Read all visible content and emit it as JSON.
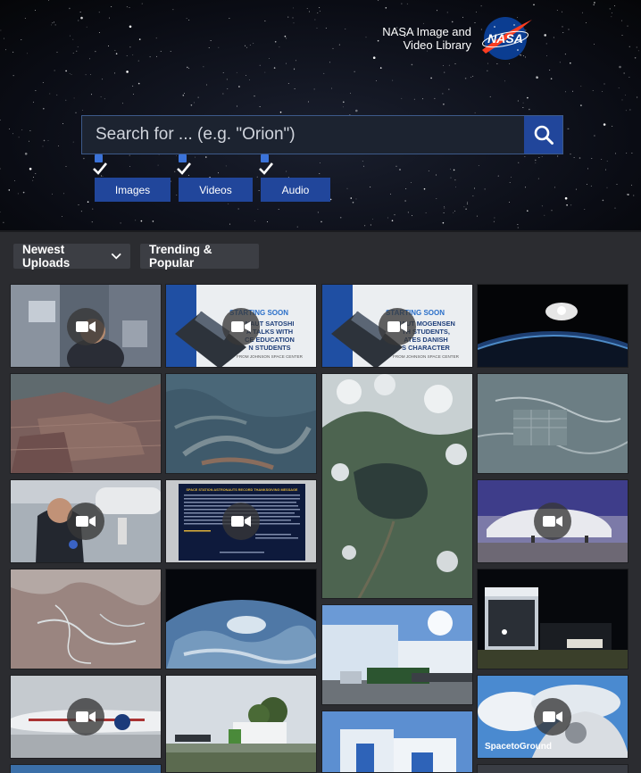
{
  "header": {
    "brand_line1": "NASA Image and",
    "brand_line2": "Video Library",
    "logo_text": "NASA"
  },
  "search": {
    "placeholder": "Search for ... (e.g. \"Orion\")",
    "value": ""
  },
  "filters": [
    {
      "label": "Images",
      "checked": true
    },
    {
      "label": "Videos",
      "checked": true
    },
    {
      "label": "Audio",
      "checked": true
    }
  ],
  "tabs": {
    "newest": "Newest Uploads",
    "trending": "Trending & Popular"
  },
  "tiles": [
    {
      "media": "video",
      "subject": "astronaut in station"
    },
    {
      "media": "video",
      "subject": "starting soon station graphic"
    },
    {
      "media": "video",
      "subject": "starting soon station graphic"
    },
    {
      "media": "image",
      "subject": "earth sunrise"
    },
    {
      "media": "image",
      "subject": "earth fields"
    },
    {
      "media": "image",
      "subject": "earth desert"
    },
    {
      "media": "image",
      "subject": "earth lake and clouds"
    },
    {
      "media": "image",
      "subject": "earth city"
    },
    {
      "media": "video",
      "subject": "person in hangar"
    },
    {
      "media": "video",
      "subject": "thanksgiving message slide"
    },
    {
      "media": "video",
      "subject": "super guppy aircraft"
    },
    {
      "media": "image",
      "subject": "earth river delta"
    },
    {
      "media": "image",
      "subject": "earth from orbit"
    },
    {
      "media": "image",
      "subject": "building with crowd"
    },
    {
      "media": "image",
      "subject": "hangar at night"
    },
    {
      "media": "video",
      "subject": "aircraft closeup"
    },
    {
      "media": "image",
      "subject": "truck convoy"
    },
    {
      "media": "image",
      "subject": "white building"
    },
    {
      "media": "video",
      "subject": "space to ground pilot"
    }
  ],
  "thumb_texts": {
    "starting_soon": "STARTING SOON",
    "s2_line1": "NAUT SATOSHI",
    "s2_line2": "A TALKS WITH",
    "s2_line3": "CE EDUCATION",
    "s2_line4": "N STUDENTS",
    "s3_line1": "NAUT MOGENSEN",
    "s3_line2": "TH STUDENTS,",
    "s3_line3": "ATES DANISH",
    "s3_line4": "S CHARACTER",
    "from_jsc": "FROM JOHNSON SPACE CENTER",
    "thanksgiving_title": "SPACE STATION ASTRONAUTS RECORD THANKSGIVING MESSAGE",
    "space_to_ground": "SpacetoGround"
  },
  "colors": {
    "accent_blue": "#21469b",
    "page_bg": "#2b2c30",
    "tab_bg": "#3c3e44",
    "nasa_logo": "#0b3d91",
    "nasa_red": "#fc3d21"
  }
}
